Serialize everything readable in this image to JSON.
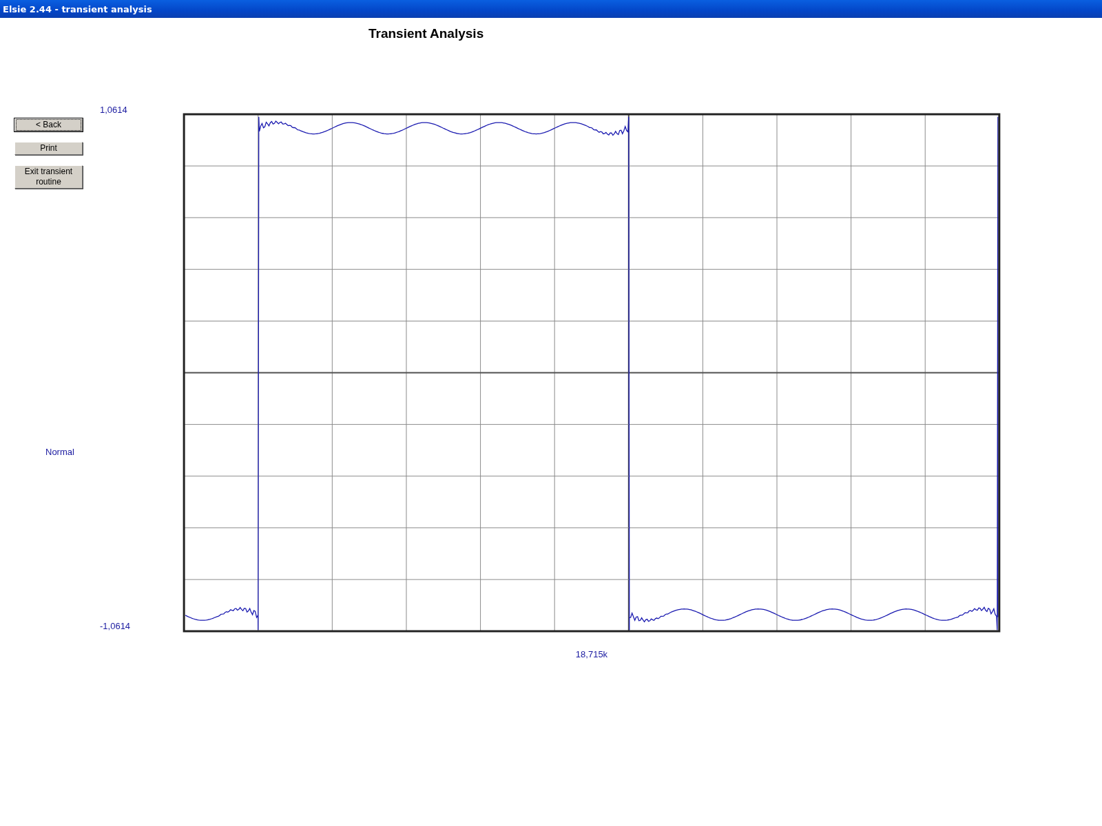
{
  "window": {
    "title": "Elsie 2.44 - transient analysis"
  },
  "heading": "Transient Analysis",
  "buttons": [
    {
      "label": "< Back",
      "default": true
    },
    {
      "label": "Print",
      "default": false
    },
    {
      "label": "Exit transient routine",
      "default": false
    }
  ],
  "mode_label": "Normal",
  "plot": {
    "y_max_label": "1,0614",
    "y_min_label": "-1,0614",
    "x_label": "18,715k"
  }
}
